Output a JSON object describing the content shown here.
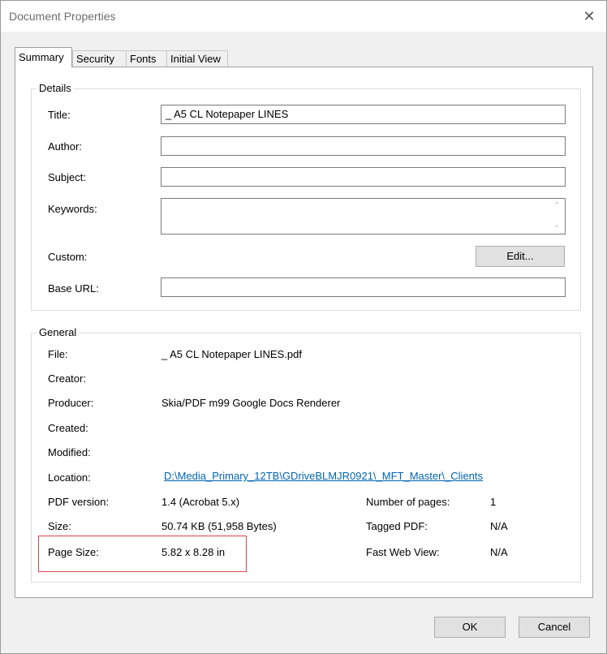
{
  "window": {
    "title": "Document Properties",
    "close_glyph": "✕"
  },
  "tabs": [
    {
      "label": "Summary",
      "active": true
    },
    {
      "label": "Security",
      "active": false
    },
    {
      "label": "Fonts",
      "active": false
    },
    {
      "label": "Initial View",
      "active": false
    }
  ],
  "details": {
    "group_label": "Details",
    "title_label": "Title:",
    "title_value": "_ A5 CL Notepaper LINES",
    "author_label": "Author:",
    "author_value": "",
    "subject_label": "Subject:",
    "subject_value": "",
    "keywords_label": "Keywords:",
    "keywords_value": "",
    "custom_label": "Custom:",
    "edit_button": "Edit...",
    "baseurl_label": "Base URL:",
    "baseurl_value": ""
  },
  "general": {
    "group_label": "General",
    "file_label": "File:",
    "file_value": "_ A5 CL Notepaper LINES.pdf",
    "creator_label": "Creator:",
    "creator_value": "",
    "producer_label": "Producer:",
    "producer_value": "Skia/PDF m99 Google Docs Renderer",
    "created_label": "Created:",
    "created_value": "",
    "modified_label": "Modified:",
    "modified_value": "",
    "location_label": "Location:",
    "location_value": "D:\\Media_Primary_12TB\\GDriveBLMJR0921\\_MFT_Master\\_Clients",
    "pdfversion_label": "PDF version:",
    "pdfversion_value": "1.4 (Acrobat 5.x)",
    "size_label": "Size:",
    "size_value": "50.74 KB (51,958 Bytes)",
    "pagesize_label": "Page Size:",
    "pagesize_value": "5.82 x 8.28 in",
    "numpages_label": "Number of pages:",
    "numpages_value": "1",
    "tagged_label": "Tagged PDF:",
    "tagged_value": "N/A",
    "fastweb_label": "Fast Web View:",
    "fastweb_value": "N/A"
  },
  "footer": {
    "ok_label": "OK",
    "cancel_label": "Cancel"
  },
  "colors": {
    "highlight": "#e0434e",
    "link": "#0063b1"
  }
}
